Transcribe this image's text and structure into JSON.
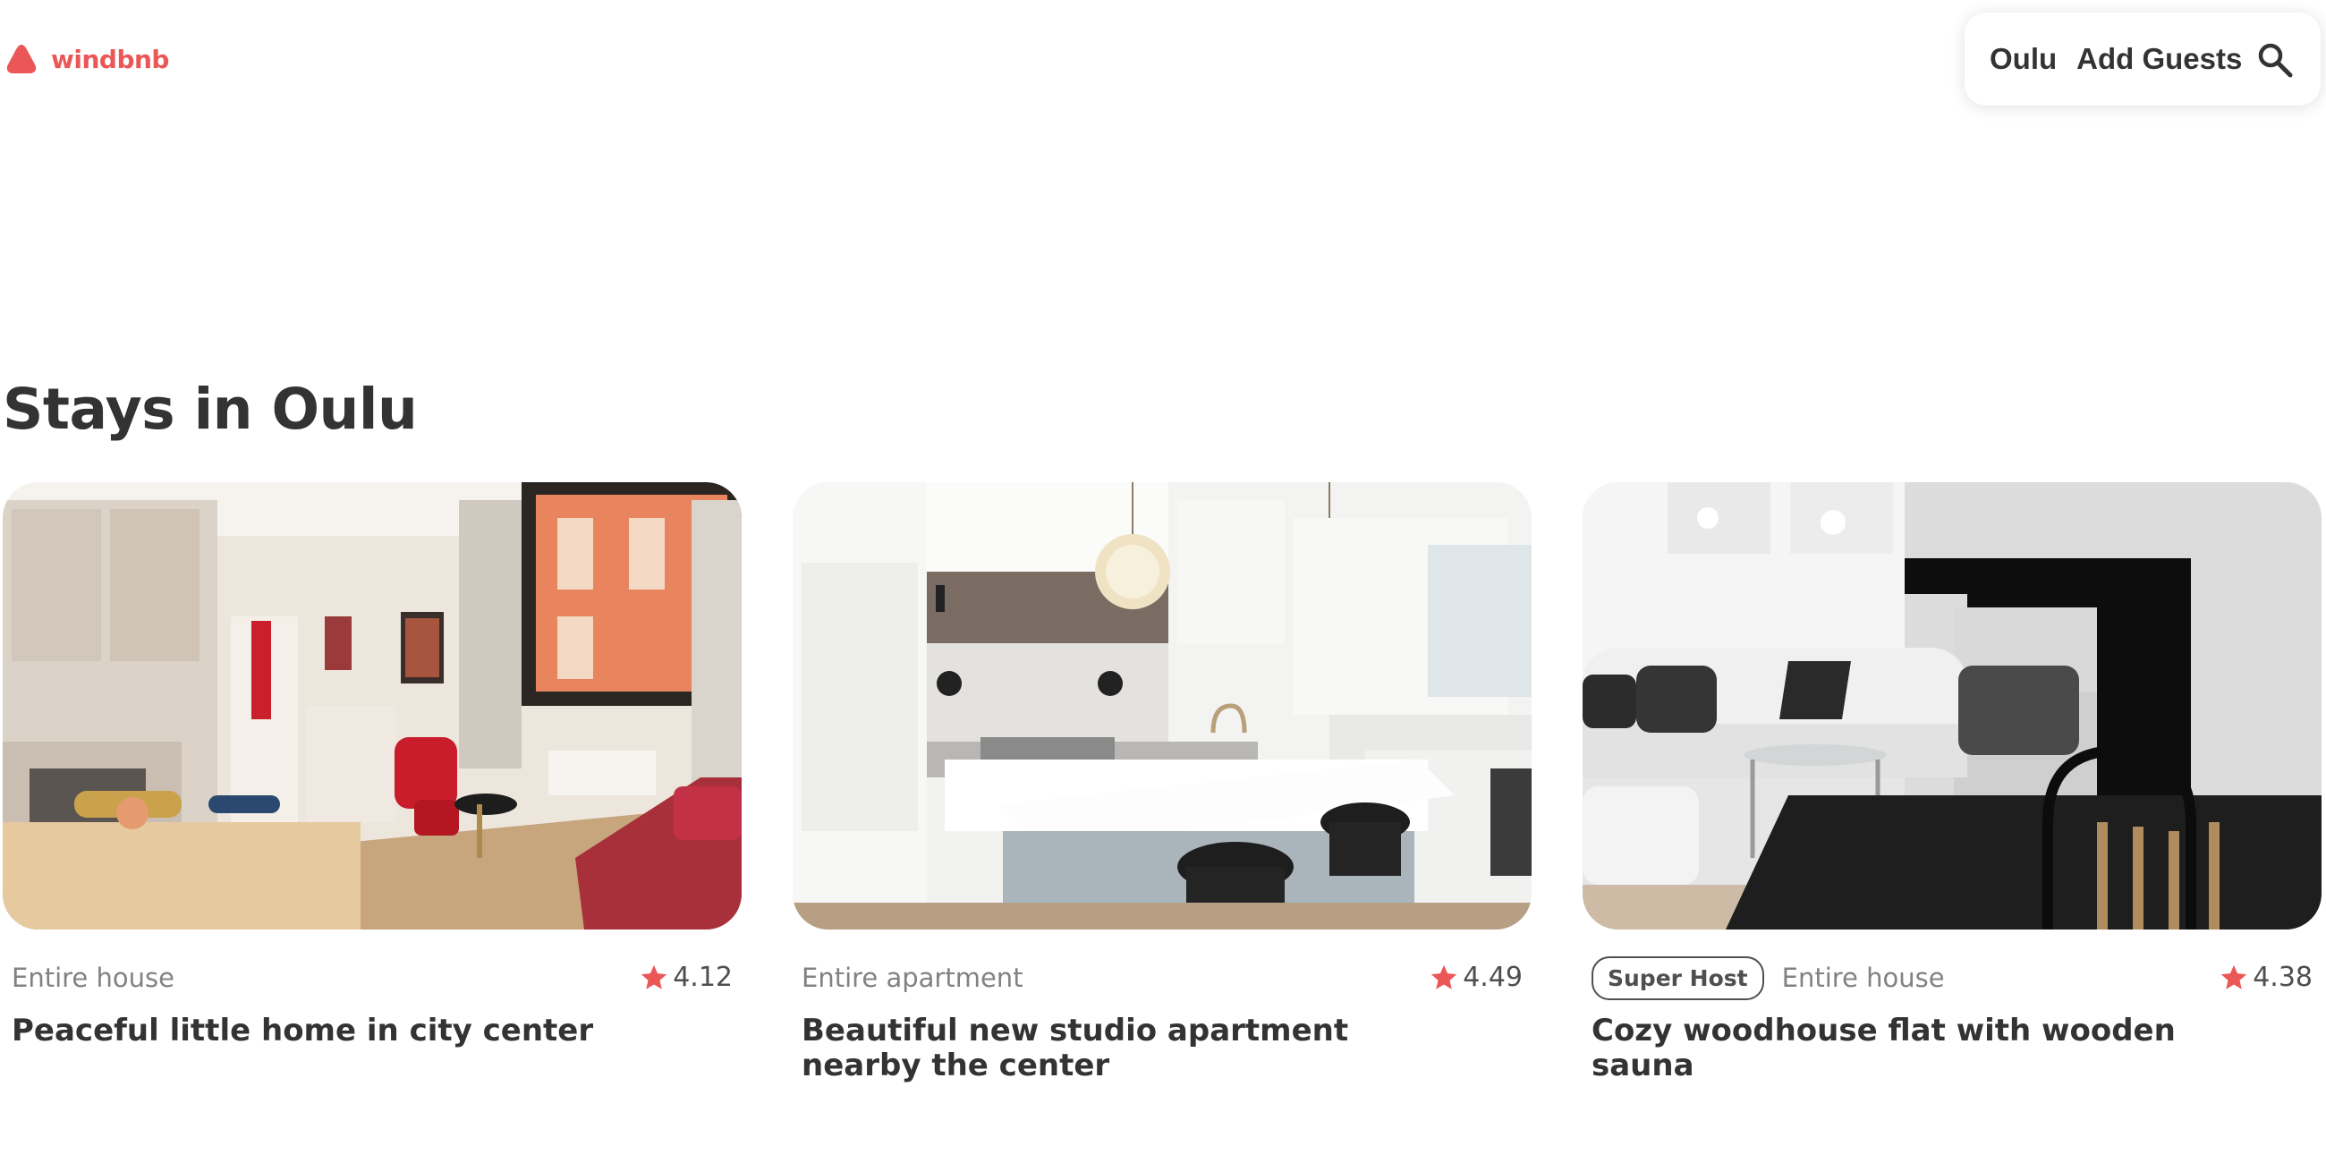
{
  "header": {
    "logo_text": "windbnb",
    "logo_icon": "logo-icon",
    "search": {
      "location": "Oulu",
      "guests_label": "Add Guests",
      "search_icon": "search-icon"
    }
  },
  "page": {
    "title": "Stays in Oulu"
  },
  "stays": [
    {
      "superhost": "",
      "type": "Entire house",
      "rating": "4.12",
      "title": "Peaceful little home in city center"
    },
    {
      "superhost": "",
      "type": "Entire apartment",
      "rating": "4.49",
      "title": "Beautiful new studio apartment nearby the center"
    },
    {
      "superhost": "Super Host",
      "type": "Entire house",
      "rating": "4.38",
      "title": "Cozy woodhouse flat with wooden sauna"
    }
  ],
  "colors": {
    "accent": "#eb5757",
    "text": "#333333",
    "muted": "#828282"
  }
}
